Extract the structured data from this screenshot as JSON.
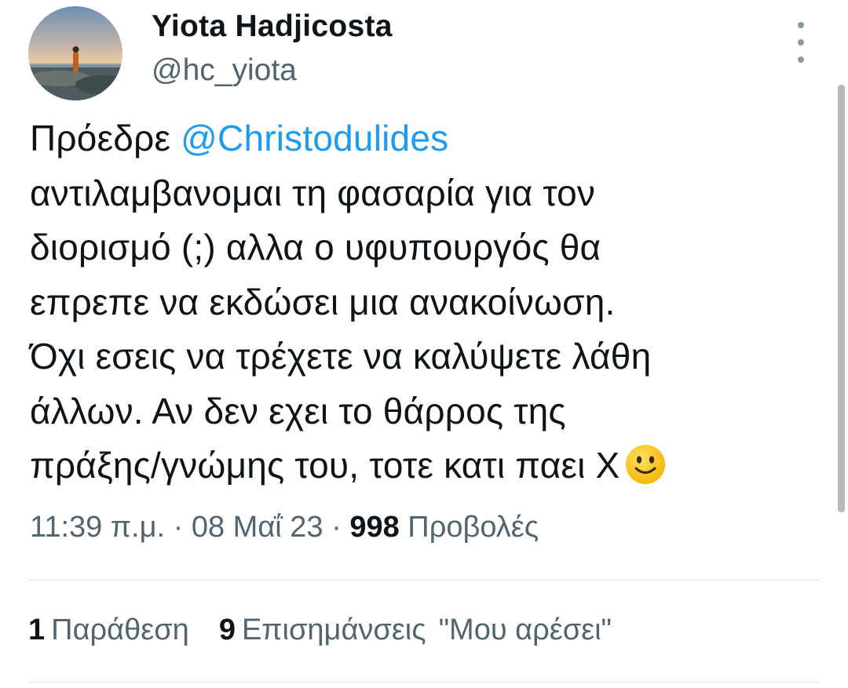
{
  "user": {
    "display_name": "Yiota Hadjicosta",
    "handle": "@hc_yiota",
    "avatar_icon": "profile-photo-seaside"
  },
  "more_icon": "vertical-ellipsis-icon",
  "tweet": {
    "line1_prefix": "Πρόεδρε ",
    "mention": "@Christodulides",
    "line2": "αντιλαμβανομαι τη φασαρία για τον",
    "line3": "διορισμό (;) αλλα ο υφυπουργός θα",
    "line4": "επρεπε να εκδώσει μια ανακοίνωση.",
    "line5": "Όχι εσεις να τρέχετε να καλύψετε λάθη",
    "line6": "άλλων. Αν δεν εχει το θάρρος της",
    "line7": "πράξης/γνώμης του, τοτε κατι παει Χ",
    "emoji_icon": "slightly-smiling-face-emoji"
  },
  "meta": {
    "time": "11:39 π.μ.",
    "sep1": " · ",
    "date": "08 Μαΐ 23",
    "sep2": " · ",
    "views_count": "998",
    "views_label": " Προβολές"
  },
  "stats": {
    "quotes_count": "1",
    "quotes_label": "Παράθεση",
    "reposts_count": "9",
    "reposts_label": "Επισημάνσεις",
    "likes_label": "\"Μου αρέσει\""
  },
  "colors": {
    "link": "#1d9bf0",
    "secondary_text": "#536471",
    "primary_text": "#0f1419",
    "divider": "#e1e5e8"
  }
}
